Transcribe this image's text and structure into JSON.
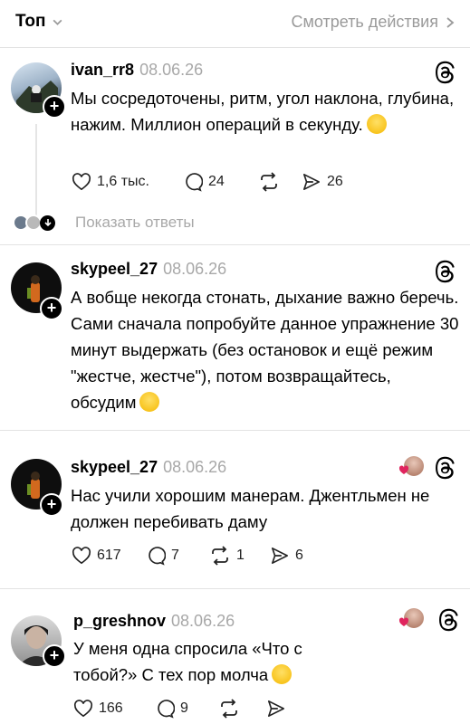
{
  "header": {
    "sort_label": "Топ",
    "view_actions_label": "Смотреть действия"
  },
  "posts": [
    {
      "username": "ivan_rr8",
      "date": "08.06.26",
      "text": "Мы сосредоточены, ритм, угол наклона, глубина, нажим. Миллион операций в секунду.",
      "emoji": "grinning-emoji",
      "likes": "1,6 тыс.",
      "replies": "24",
      "reposts": "",
      "shares": "26",
      "show_replies": "Показать ответы"
    },
    {
      "username": "skypeel_27",
      "date": "08.06.26",
      "text": "А вобще некогда стонать, дыхание важно беречь. Сами сначала попробуйте данное упражнение 30 минут выдержать (без остановок и ещё режим \"жестче, жестче\"), потом возвращайтесь, обсудим",
      "emoji": "tears-of-joy-emoji"
    },
    {
      "username": "skypeel_27",
      "date": "08.06.26",
      "text": "Нас учили хорошим манерам. Джентльмен не должен перебивать даму",
      "likes": "617",
      "replies": "7",
      "reposts": "1",
      "shares": "6"
    },
    {
      "username": "p_greshnov",
      "date": "08.06.26",
      "text": "У меня одна спросила «Что с тобой?» С тех пор молча",
      "emoji": "zipper-mouth-emoji",
      "likes": "166",
      "replies": "9",
      "reposts": "",
      "shares": ""
    }
  ],
  "colors": {
    "muted": "#a8a8a8",
    "line": "#e5e5e5",
    "heart": "#e0245e"
  }
}
